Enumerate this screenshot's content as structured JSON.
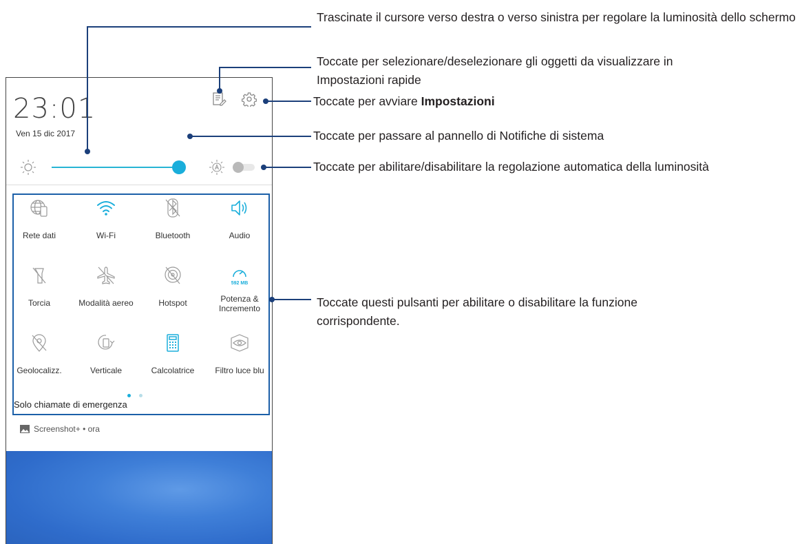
{
  "status": {
    "time": "23:01",
    "date": "Ven 15 dic 2017"
  },
  "brightness": {
    "level_percent": 100,
    "auto_enabled": false
  },
  "tiles": [
    {
      "label": "Rete dati",
      "icon": "mobile-data-icon",
      "active": false
    },
    {
      "label": "Wi-Fi",
      "icon": "wifi-icon",
      "active": true
    },
    {
      "label": "Bluetooth",
      "icon": "bluetooth-off-icon",
      "active": false
    },
    {
      "label": "Audio",
      "icon": "speaker-icon",
      "active": true
    },
    {
      "label": "Torcia",
      "icon": "flashlight-off-icon",
      "active": false
    },
    {
      "label": "Modalità aereo",
      "icon": "airplane-off-icon",
      "active": false
    },
    {
      "label": "Hotspot",
      "icon": "hotspot-off-icon",
      "active": false
    },
    {
      "label": "Potenza & Incremento",
      "icon": "boost-gauge-icon",
      "active": true,
      "badge": "592 MB"
    },
    {
      "label": "Geolocalizz.",
      "icon": "location-off-icon",
      "active": false
    },
    {
      "label": "Verticale",
      "icon": "rotation-lock-icon",
      "active": false
    },
    {
      "label": "Calcolatrice",
      "icon": "calculator-icon",
      "active": true
    },
    {
      "label": "Filtro luce blu",
      "icon": "eye-filter-icon",
      "active": false
    }
  ],
  "emergency_text": "Solo chiamate di emergenza",
  "notification": {
    "app": "Screenshot+",
    "sep": "•",
    "time": "ora"
  },
  "callouts": {
    "slider": "Trascinate il cursore verso destra o verso sinistra per regolare la luminosità dello schermo",
    "edit": "Toccate per selezionare/deselezionare gli oggetti da visualizzare in Impostazioni rapide",
    "settings_prefix": "Toccate per avviare",
    "settings_bold": "Impostazioni",
    "notifications": "Toccate per passare al pannello di Notifiche di sistema",
    "auto_brightness": "Toccate per abilitare/disabilitare la regolazione automatica della luminosità",
    "tiles": "Toccate questi pulsanti per abilitare o disabilitare la funzione corrispondente."
  },
  "colors": {
    "accent": "#1aaedb",
    "inactive_icon": "#9a9a9a",
    "callout_line": "#1b3f7a",
    "highlight_box": "#1b5fa8",
    "wallpaper": "#3f7fd8"
  }
}
